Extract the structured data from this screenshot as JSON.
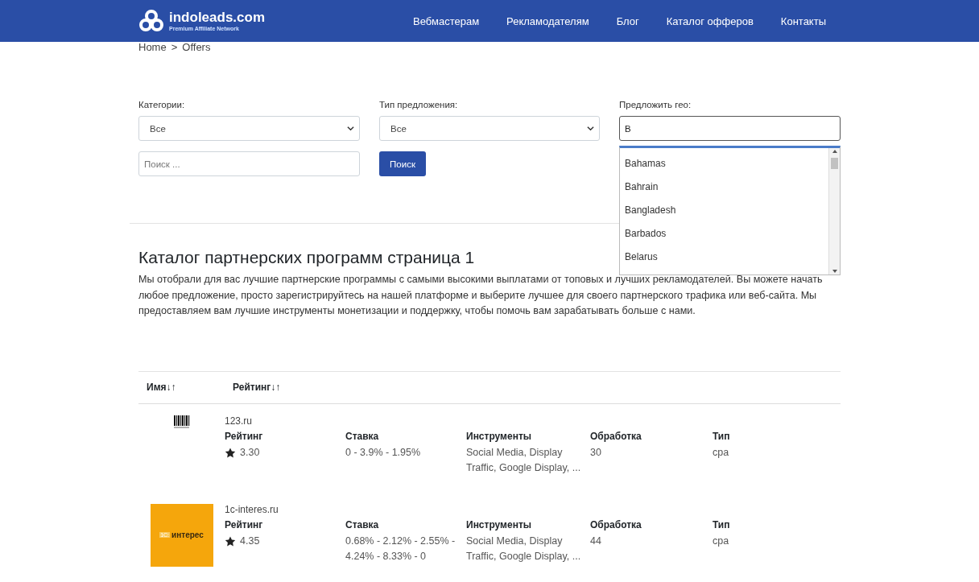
{
  "header": {
    "logo_name": "indoleads.com",
    "logo_tagline": "Premium Affiliate Network",
    "nav": [
      "Вебмастерам",
      "Рекламодателям",
      "Блог",
      "Каталог офферов",
      "Контакты"
    ]
  },
  "breadcrumb": [
    "Home",
    ">",
    "Offers"
  ],
  "filters": {
    "category": {
      "label": "Категории:",
      "value": "Все"
    },
    "offer_type": {
      "label": "Тип предложения:",
      "value": "Все"
    },
    "geo": {
      "label": "Предложить гео:",
      "value": "B",
      "suggestions": [
        "Bahamas",
        "Bahrain",
        "Bangladesh",
        "Barbados",
        "Belarus"
      ]
    },
    "search": {
      "placeholder": "Поиск ..."
    },
    "search_button": "Поиск"
  },
  "catalog": {
    "title": "Каталог партнерских программ страница 1",
    "description": "Мы отобрали для вас лучшие партнерские программы с самыми высокими выплатами от топовых и лучших рекламодателей. Вы можете начать любое предложение, просто зарегистрируйтесь на нашей платформе и выберите лучшее для своего партнерского трафика или веб-сайта. Мы предоставляем вам лучшие инструменты монетизации и поддержку, чтобы помочь вам зарабатывать больше с нами."
  },
  "table": {
    "sort_columns": [
      {
        "label": "Имя",
        "down": "↓",
        "up": "↑"
      },
      {
        "label": "Рейтинг",
        "down": "↓",
        "up": "↑"
      }
    ],
    "rows": [
      {
        "logo": {
          "kind": "barcode"
        },
        "name": "123.ru",
        "fields": [
          {
            "label": "Рейтинг",
            "value": "3.30",
            "kind": "rating"
          },
          {
            "label": "Ставка",
            "value": "0 - 3.9% - 1.95%",
            "kind": "text"
          },
          {
            "label": "Инструменты",
            "value": "Social Media, Display Traffic, Google Display, ...",
            "kind": "text"
          },
          {
            "label": "Обработка",
            "value": "30",
            "kind": "text"
          },
          {
            "label": "Тип",
            "value": "cpa",
            "kind": "text"
          }
        ]
      },
      {
        "logo": {
          "kind": "tile",
          "badge": "1С:",
          "text": "интерес"
        },
        "name": "1c-interes.ru",
        "fields": [
          {
            "label": "Рейтинг",
            "value": "4.35",
            "kind": "rating"
          },
          {
            "label": "Ставка",
            "value": "0.68% - 2.12% - 2.55% - 4.24% - 8.33% - 0",
            "kind": "text"
          },
          {
            "label": "Инструменты",
            "value": "Social Media, Display Traffic, Google Display, ...",
            "kind": "text"
          },
          {
            "label": "Обработка",
            "value": "44",
            "kind": "text"
          },
          {
            "label": "Тип",
            "value": "cpa",
            "kind": "text"
          }
        ]
      }
    ]
  }
}
